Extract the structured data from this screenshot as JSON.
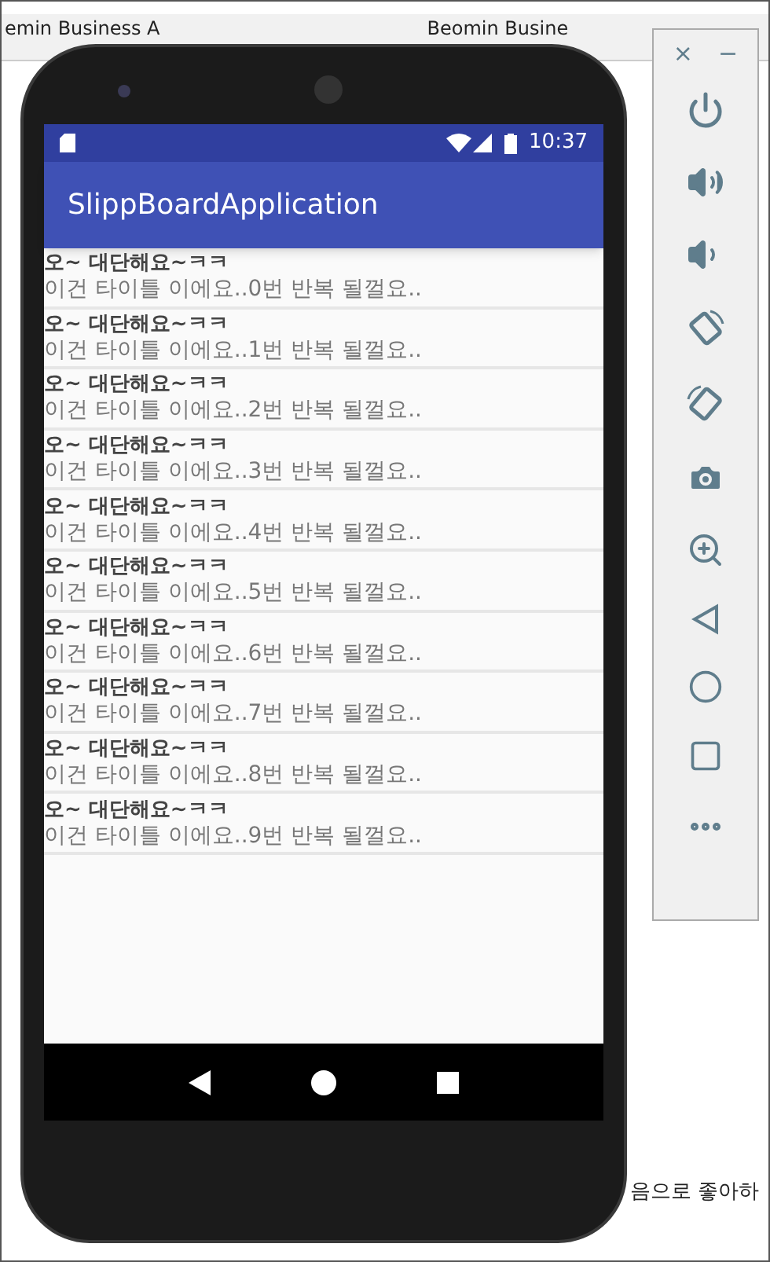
{
  "browser_tabs": [
    {
      "title": "emin Business A"
    },
    {
      "title": "Beomin Busine"
    }
  ],
  "page_text": "음으로 좋아하",
  "emulator": {
    "window_controls": [
      "×",
      "−"
    ],
    "status_bar": {
      "time": "10:37"
    },
    "app_bar": {
      "title": "SlippBoardApplication"
    },
    "list": [
      {
        "title": "오~ 대단해요~ㅋㅋ",
        "subtitle": "이건 타이틀 이에요..0번 반복 될껄요.."
      },
      {
        "title": "오~ 대단해요~ㅋㅋ",
        "subtitle": "이건 타이틀 이에요..1번 반복 될껄요.."
      },
      {
        "title": "오~ 대단해요~ㅋㅋ",
        "subtitle": "이건 타이틀 이에요..2번 반복 될껄요.."
      },
      {
        "title": "오~ 대단해요~ㅋㅋ",
        "subtitle": "이건 타이틀 이에요..3번 반복 될껄요.."
      },
      {
        "title": "오~ 대단해요~ㅋㅋ",
        "subtitle": "이건 타이틀 이에요..4번 반복 될껄요.."
      },
      {
        "title": "오~ 대단해요~ㅋㅋ",
        "subtitle": "이건 타이틀 이에요..5번 반복 될껄요.."
      },
      {
        "title": "오~ 대단해요~ㅋㅋ",
        "subtitle": "이건 타이틀 이에요..6번 반복 될껄요.."
      },
      {
        "title": "오~ 대단해요~ㅋㅋ",
        "subtitle": "이건 타이틀 이에요..7번 반복 될껄요.."
      },
      {
        "title": "오~ 대단해요~ㅋㅋ",
        "subtitle": "이건 타이틀 이에요..8번 반복 될껄요.."
      },
      {
        "title": "오~ 대단해요~ㅋㅋ",
        "subtitle": "이건 타이틀 이에요..9번 반복 될껄요.."
      }
    ]
  }
}
